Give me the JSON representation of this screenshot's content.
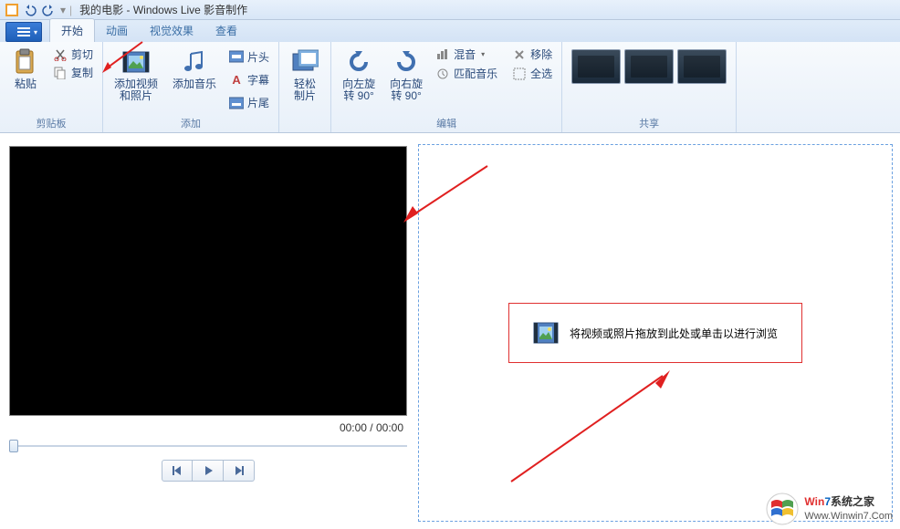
{
  "title": "我的电影 - Windows Live 影音制作",
  "tabs": {
    "home": "开始",
    "animation": "动画",
    "vfx": "视觉效果",
    "view": "查看"
  },
  "ribbon": {
    "clipboard": {
      "label": "剪贴板",
      "paste": "粘贴",
      "cut": "剪切",
      "copy": "复制"
    },
    "add": {
      "label": "添加",
      "addVideoPhoto": "添加视频\n和照片",
      "addMusic": "添加音乐",
      "titleCard": "片头",
      "caption": "字幕",
      "endCard": "片尾"
    },
    "easy": {
      "label": "",
      "easyMake": "轻松\n制片"
    },
    "edit": {
      "label": "编辑",
      "rotLeft": "向左旋\n转 90°",
      "rotRight": "向右旋\n转 90°",
      "mix": "混音",
      "matchMusic": "匹配音乐",
      "remove": "移除",
      "selectAll": "全选"
    },
    "share": {
      "label": "共享"
    }
  },
  "player": {
    "time": "00:00 / 00:00"
  },
  "dropzone": {
    "text": "将视频或照片拖放到此处或单击以进行浏览"
  },
  "watermark": {
    "brand1": "Win",
    "brand2": "7",
    "brand3": "系统之家",
    "url": "Www.Winwin7.Com"
  }
}
